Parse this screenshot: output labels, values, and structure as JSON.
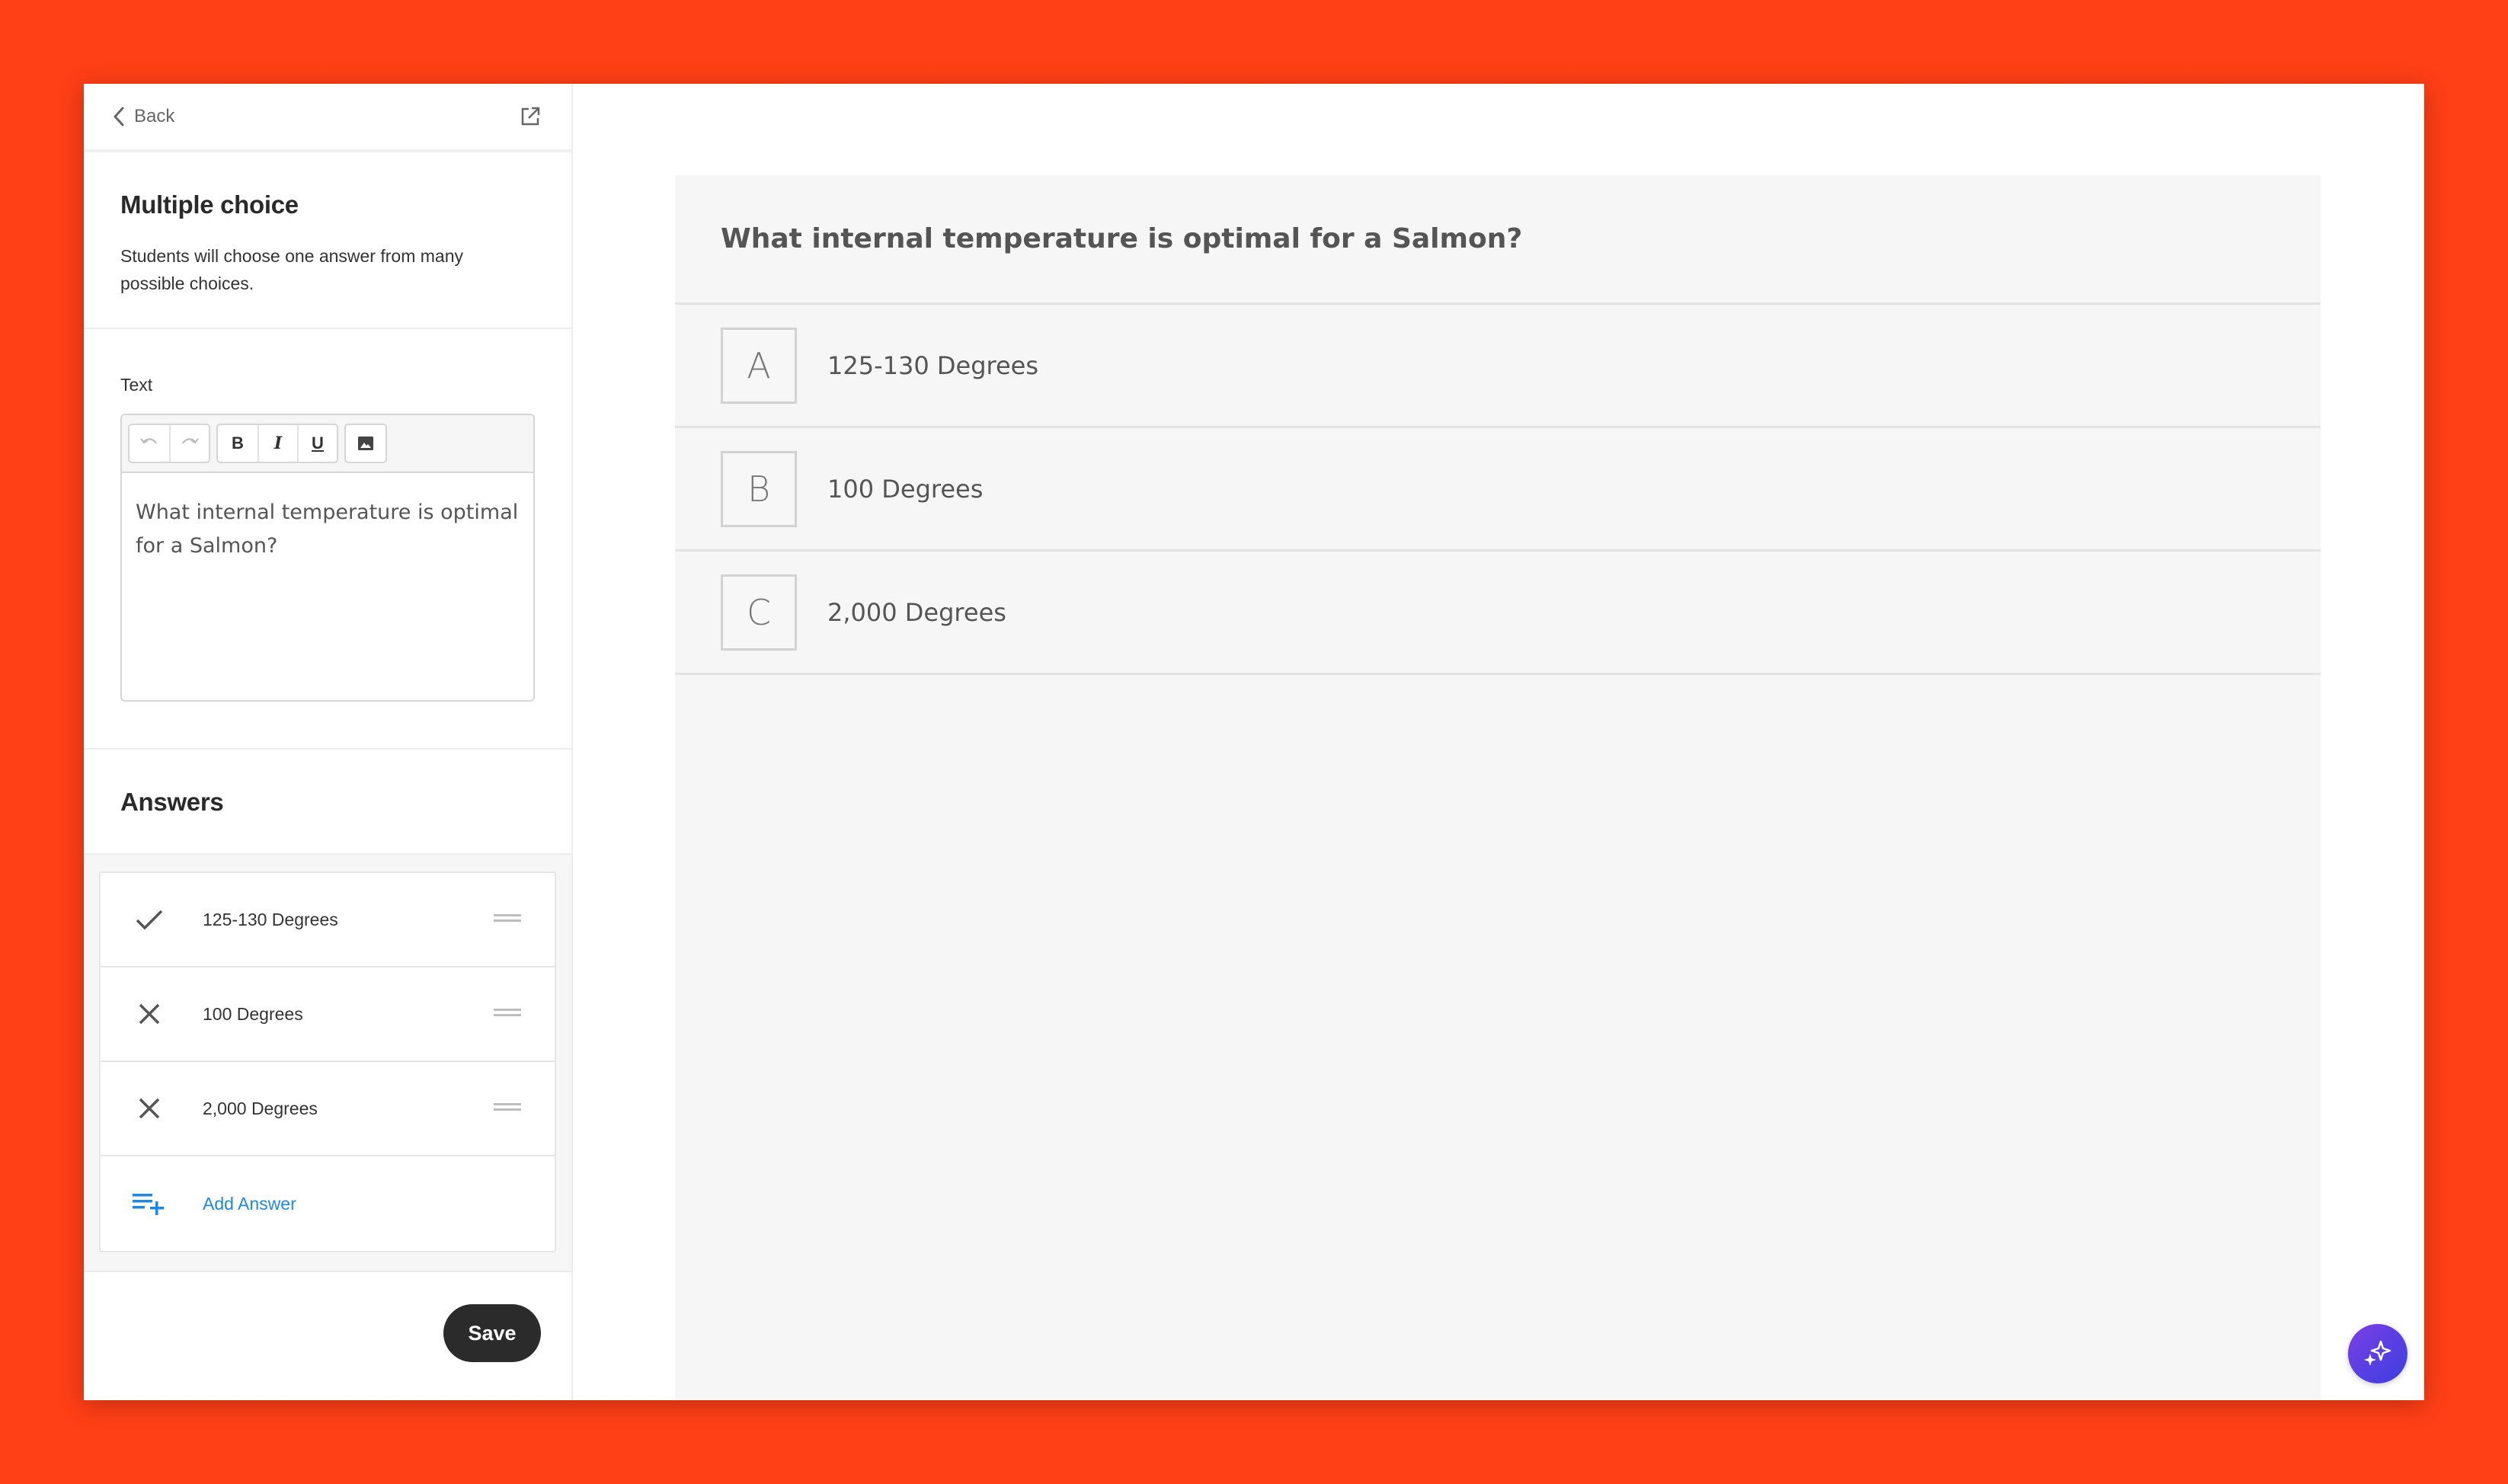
{
  "sidebar": {
    "back_label": "Back",
    "intro": {
      "title": "Multiple choice",
      "description": "Students will choose one answer from many possible choices."
    },
    "text_section": {
      "label": "Text",
      "toolbar": {
        "bold": "B",
        "italic": "I",
        "underline": "U"
      },
      "content": "What internal temperature is optimal for a Salmon?"
    },
    "answers": {
      "title": "Answers",
      "items": [
        {
          "label": "125-130 Degrees",
          "correct": true
        },
        {
          "label": "100 Degrees",
          "correct": false
        },
        {
          "label": "2,000 Degrees",
          "correct": false
        }
      ],
      "add_label": "Add Answer"
    },
    "save_label": "Save"
  },
  "preview": {
    "question": "What internal temperature is optimal for a Salmon?",
    "options": [
      {
        "letter": "A",
        "text": "125-130 Degrees"
      },
      {
        "letter": "B",
        "text": "100 Degrees"
      },
      {
        "letter": "C",
        "text": "2,000 Degrees"
      }
    ]
  },
  "colors": {
    "background": "#ff3f16",
    "accent": "#1e88e5",
    "save_button": "#2b2b2b",
    "fab_gradient_start": "#7b3fe4",
    "fab_gradient_end": "#3b3fe0"
  },
  "icons": {
    "back": "chevron-left-icon",
    "external": "external-link-icon",
    "correct": "check-icon",
    "incorrect": "close-icon",
    "drag": "drag-handle-icon",
    "add": "playlist-add-icon",
    "assistant": "sparkle-icon"
  }
}
